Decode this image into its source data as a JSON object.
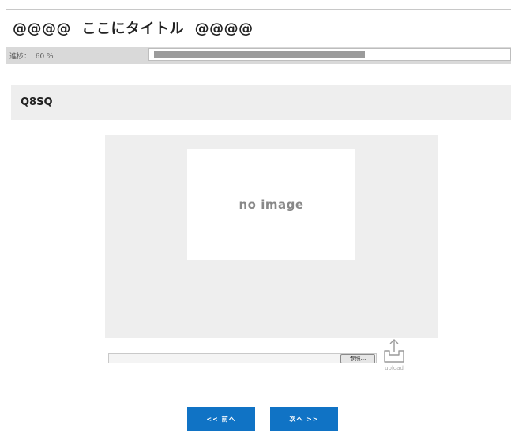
{
  "header": {
    "title": "@@@@  ここにタイトル  @@@@"
  },
  "progress": {
    "label": "進捗：  60 %",
    "value_percent": 60
  },
  "question": {
    "label": "Q8SQ"
  },
  "image_area": {
    "placeholder_text": "no image"
  },
  "file_upload": {
    "browse_label": "参照...",
    "upload_icon": "upload-tray-icon",
    "upload_label": "upload"
  },
  "navigation": {
    "prev_label": "<< 前へ",
    "next_label": "次へ >>",
    "button_color": "#1073c5"
  },
  "colors": {
    "progress_bar_background": "#d9d9d9",
    "progress_fill": "#9b9b9b",
    "panel_background": "#eeeeee"
  }
}
